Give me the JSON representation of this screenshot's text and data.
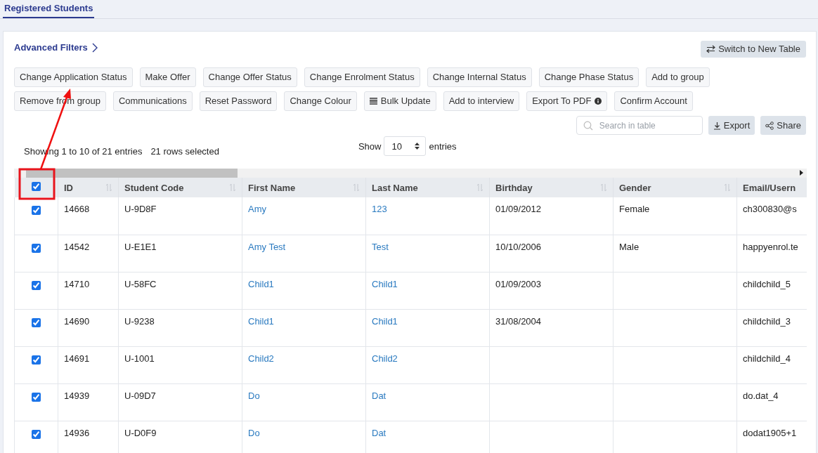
{
  "tabs": [
    {
      "label": "Registered Students",
      "selected": true
    }
  ],
  "advanced_filters": "Advanced Filters",
  "switch_button": "Switch to New Table",
  "actions": [
    {
      "label": "Change Application Status",
      "kind": "plain"
    },
    {
      "label": "Make Offer",
      "kind": "plain"
    },
    {
      "label": "Change Offer Status",
      "kind": "plain"
    },
    {
      "label": "Change Enrolment Status",
      "kind": "plain"
    },
    {
      "label": "Change Internal Status",
      "kind": "plain"
    },
    {
      "label": "Change Phase Status",
      "kind": "plain"
    },
    {
      "label": "Add to group",
      "kind": "plain"
    },
    {
      "label": "Remove from group",
      "kind": "plain"
    },
    {
      "label": "Communications",
      "kind": "plain"
    },
    {
      "label": "Reset Password",
      "kind": "plain"
    },
    {
      "label": "Change Colour",
      "kind": "plain"
    },
    {
      "label": "Bulk Update",
      "kind": "list"
    },
    {
      "label": "Add to interview",
      "kind": "plain"
    },
    {
      "label": "Export To PDF",
      "kind": "info"
    },
    {
      "label": "Confirm Account",
      "kind": "plain"
    }
  ],
  "search": {
    "placeholder": "Search in table"
  },
  "export_button": "Export",
  "share_button": "Share",
  "info": "Showing 1 to 10 of 21 entries",
  "selection_count": "21 rows selected",
  "page_length": {
    "label": "Show",
    "value": "10",
    "suffix": "entries"
  },
  "table": {
    "all_selected": true,
    "columns": [
      {
        "label": "ID",
        "sortable": true,
        "link": false
      },
      {
        "label": "Student Code",
        "sortable": true,
        "link": false
      },
      {
        "label": "First Name",
        "sortable": true,
        "link": true
      },
      {
        "label": "Last Name",
        "sortable": true,
        "link": true
      },
      {
        "label": "Birthday",
        "sortable": true,
        "link": false
      },
      {
        "label": "Gender",
        "sortable": true,
        "link": false
      },
      {
        "label": "Email/Usern",
        "sortable": false,
        "link": false
      }
    ],
    "rows": [
      {
        "selected": true,
        "cells": [
          "14668",
          "U-9D8F",
          "Amy",
          "123",
          "01/09/2012",
          "Female",
          "ch300830@s"
        ]
      },
      {
        "selected": true,
        "cells": [
          "14542",
          "U-E1E1",
          "Amy Test",
          "Test",
          "10/10/2006",
          "Male",
          "happyenrol.te"
        ]
      },
      {
        "selected": true,
        "cells": [
          "14710",
          "U-58FC",
          "Child1",
          "Child1",
          "01/09/2003",
          "",
          "childchild_5"
        ]
      },
      {
        "selected": true,
        "cells": [
          "14690",
          "U-9238",
          "Child1",
          "Child1",
          "31/08/2004",
          "",
          "childchild_3"
        ]
      },
      {
        "selected": true,
        "cells": [
          "14691",
          "U-1001",
          "Child2",
          "Child2",
          "",
          "",
          "childchild_4"
        ]
      },
      {
        "selected": true,
        "cells": [
          "14939",
          "U-09D7",
          "Do",
          "Dat",
          "",
          "",
          "do.dat_4"
        ]
      },
      {
        "selected": true,
        "cells": [
          "14936",
          "U-D0F9",
          "Do",
          "Dat",
          "",
          "",
          "dodat1905+1"
        ]
      }
    ]
  }
}
